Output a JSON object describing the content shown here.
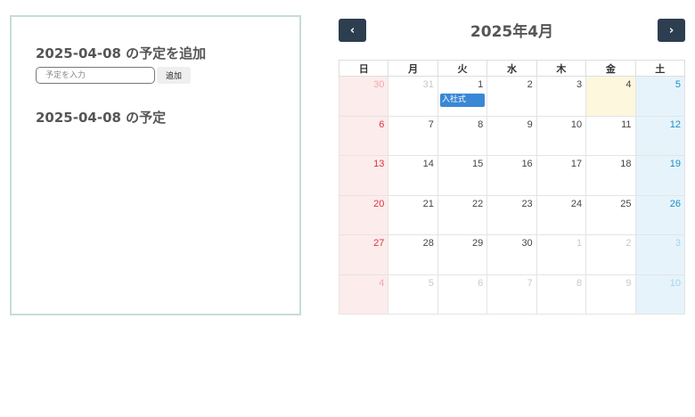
{
  "panel": {
    "add_title": "2025-04-08 の予定を追加",
    "input_placeholder": "予定を入力",
    "input_value": "",
    "add_button": "追加",
    "list_title": "2025-04-08 の予定"
  },
  "calendar": {
    "title": "2025年4月",
    "prev_icon": "chevron-left-icon",
    "next_icon": "chevron-right-icon",
    "prev_glyph": "‹",
    "next_glyph": "›",
    "weekdays": [
      "日",
      "月",
      "火",
      "水",
      "木",
      "金",
      "土"
    ],
    "weeks": [
      [
        "30",
        "31",
        "1",
        "2",
        "3",
        "4",
        "5"
      ],
      [
        "6",
        "7",
        "8",
        "9",
        "10",
        "11",
        "12"
      ],
      [
        "13",
        "14",
        "15",
        "16",
        "17",
        "18",
        "19"
      ],
      [
        "20",
        "21",
        "22",
        "23",
        "24",
        "25",
        "26"
      ],
      [
        "27",
        "28",
        "29",
        "30",
        "1",
        "2",
        "3"
      ],
      [
        "4",
        "5",
        "6",
        "7",
        "8",
        "9",
        "10"
      ]
    ],
    "event": {
      "label": "入社式",
      "date": "2025-04-01",
      "color": "#3a87d6"
    },
    "colors": {
      "nav_bg": "#2c3e50",
      "sunday_bg": "#fdecec",
      "saturday_bg": "#e6f3fb",
      "today_bg": "#fcf7dd",
      "panel_border": "#c6ddd6"
    }
  }
}
